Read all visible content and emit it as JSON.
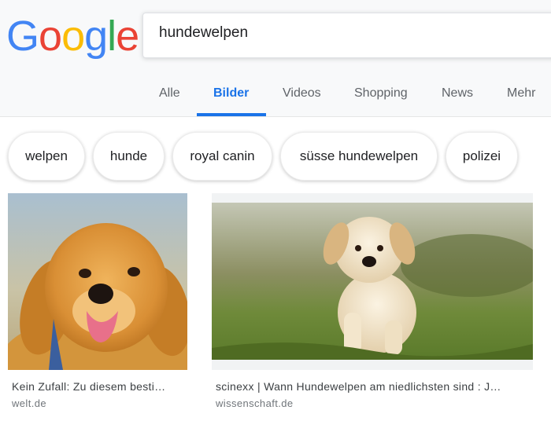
{
  "logo": {
    "letters": [
      "G",
      "o",
      "o",
      "g",
      "l",
      "e"
    ],
    "colors": [
      "#4285f4",
      "#ea4335",
      "#fbbc05",
      "#4285f4",
      "#34a853",
      "#ea4335"
    ]
  },
  "search": {
    "value": "hundewelpen"
  },
  "tabs": [
    {
      "label": "Alle"
    },
    {
      "label": "Bilder",
      "active": true
    },
    {
      "label": "Videos"
    },
    {
      "label": "Shopping"
    },
    {
      "label": "News"
    },
    {
      "label": "Mehr"
    }
  ],
  "chips": [
    {
      "label": "welpen"
    },
    {
      "label": "hunde"
    },
    {
      "label": "royal canin"
    },
    {
      "label": "süsse hundewelpen"
    },
    {
      "label": "polizei"
    }
  ],
  "results": [
    {
      "caption": "Kein Zufall: Zu diesem besti…",
      "source": "welt.de",
      "image": "golden-retriever-puppy-smiling"
    },
    {
      "caption": "scinexx | Wann Hundewelpen am niedlichsten sind : J…",
      "source": "wissenschaft.de",
      "image": "labrador-puppy-running-on-grass"
    }
  ],
  "colors": {
    "accent": "#1a73e8"
  }
}
